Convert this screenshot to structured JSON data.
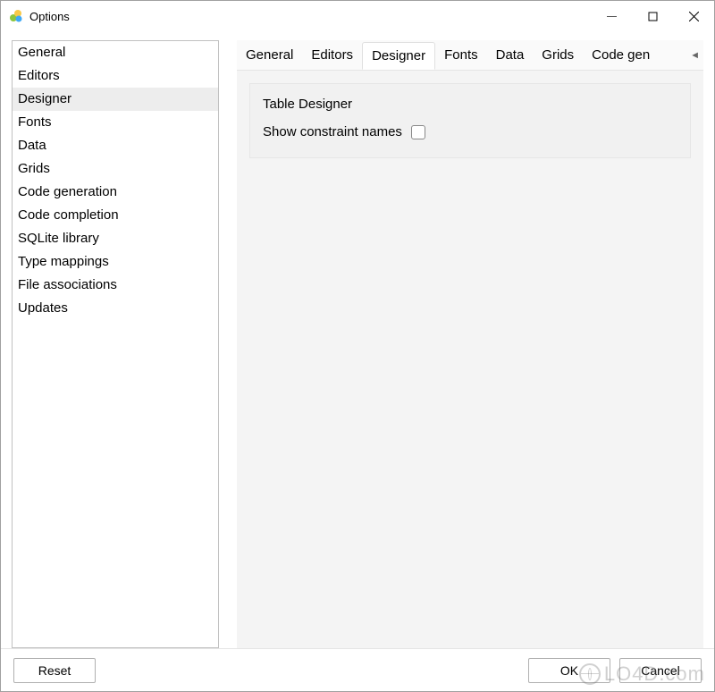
{
  "window": {
    "title": "Options"
  },
  "sidebar": {
    "items": [
      {
        "label": "General",
        "selected": false
      },
      {
        "label": "Editors",
        "selected": false
      },
      {
        "label": "Designer",
        "selected": true
      },
      {
        "label": "Fonts",
        "selected": false
      },
      {
        "label": "Data",
        "selected": false
      },
      {
        "label": "Grids",
        "selected": false
      },
      {
        "label": "Code generation",
        "selected": false
      },
      {
        "label": "Code completion",
        "selected": false
      },
      {
        "label": "SQLite library",
        "selected": false
      },
      {
        "label": "Type mappings",
        "selected": false
      },
      {
        "label": "File associations",
        "selected": false
      },
      {
        "label": "Updates",
        "selected": false
      }
    ]
  },
  "tabs": {
    "items": [
      {
        "label": "General",
        "active": false
      },
      {
        "label": "Editors",
        "active": false
      },
      {
        "label": "Designer",
        "active": true
      },
      {
        "label": "Fonts",
        "active": false
      },
      {
        "label": "Data",
        "active": false
      },
      {
        "label": "Grids",
        "active": false
      },
      {
        "label": "Code gen",
        "active": false
      }
    ],
    "scroll_indicator": "◄"
  },
  "panel": {
    "group_title": "Table Designer",
    "checkbox_label": "Show constraint names",
    "checkbox_checked": false
  },
  "footer": {
    "reset_label": "Reset",
    "ok_label": "OK",
    "cancel_label": "Cancel"
  },
  "watermark": "LO4D.com"
}
